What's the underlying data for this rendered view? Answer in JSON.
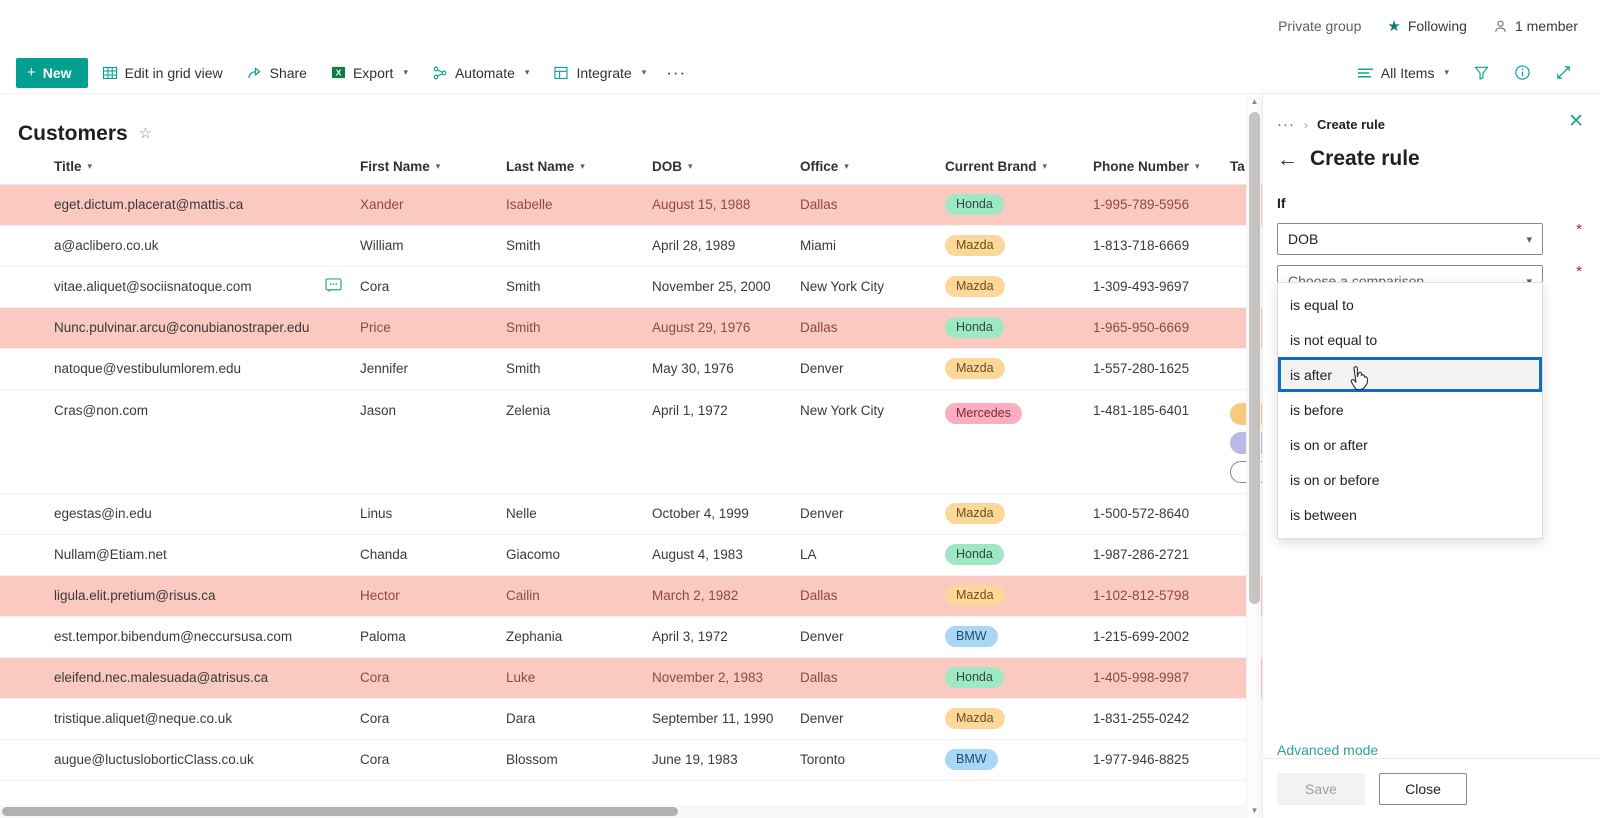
{
  "site_bar": {
    "privacy_label": "Private group",
    "following_label": "Following",
    "members_label": "1 member"
  },
  "command_bar": {
    "new_label": "New",
    "edit_grid_label": "Edit in grid view",
    "share_label": "Share",
    "export_label": "Export",
    "automate_label": "Automate",
    "integrate_label": "Integrate",
    "overflow_label": "···",
    "view_label": "All Items"
  },
  "list": {
    "title": "Customers",
    "columns": [
      "Title",
      "First Name",
      "Last Name",
      "DOB",
      "Office",
      "Current Brand",
      "Phone Number",
      "Ta"
    ],
    "rows": [
      {
        "title": "eget.dictum.placerat@mattis.ca",
        "first": "Xander",
        "last": "Isabelle",
        "dob": "August 15, 1988",
        "office": "Dallas",
        "brand": "Honda",
        "brand_class": "honda",
        "phone": "1-995-789-5956",
        "flagged": true,
        "note": false,
        "tall": false,
        "tags": []
      },
      {
        "title": "a@aclibero.co.uk",
        "first": "William",
        "last": "Smith",
        "dob": "April 28, 1989",
        "office": "Miami",
        "brand": "Mazda",
        "brand_class": "mazda",
        "phone": "1-813-718-6669",
        "flagged": false,
        "note": false,
        "tall": false,
        "tags": []
      },
      {
        "title": "vitae.aliquet@sociisnatoque.com",
        "first": "Cora",
        "last": "Smith",
        "dob": "November 25, 2000",
        "office": "New York City",
        "brand": "Mazda",
        "brand_class": "mazda",
        "phone": "1-309-493-9697",
        "flagged": false,
        "note": true,
        "tall": false,
        "tags": []
      },
      {
        "title": "Nunc.pulvinar.arcu@conubianostraper.edu",
        "first": "Price",
        "last": "Smith",
        "dob": "August 29, 1976",
        "office": "Dallas",
        "brand": "Honda",
        "brand_class": "honda",
        "phone": "1-965-950-6669",
        "flagged": true,
        "note": false,
        "tall": false,
        "tags": []
      },
      {
        "title": "natoque@vestibulumlorem.edu",
        "first": "Jennifer",
        "last": "Smith",
        "dob": "May 30, 1976",
        "office": "Denver",
        "brand": "Mazda",
        "brand_class": "mazda",
        "phone": "1-557-280-1625",
        "flagged": false,
        "note": false,
        "tall": false,
        "tags": []
      },
      {
        "title": "Cras@non.com",
        "first": "Jason",
        "last": "Zelenia",
        "dob": "April 1, 1972",
        "office": "New York City",
        "brand": "Mercedes",
        "brand_class": "mercedes",
        "phone": "1-481-185-6401",
        "flagged": false,
        "note": false,
        "tall": true,
        "tags": [
          "t-orange",
          "t-purple",
          "t-plain"
        ]
      },
      {
        "title": "egestas@in.edu",
        "first": "Linus",
        "last": "Nelle",
        "dob": "October 4, 1999",
        "office": "Denver",
        "brand": "Mazda",
        "brand_class": "mazda",
        "phone": "1-500-572-8640",
        "flagged": false,
        "note": false,
        "tall": false,
        "tags": []
      },
      {
        "title": "Nullam@Etiam.net",
        "first": "Chanda",
        "last": "Giacomo",
        "dob": "August 4, 1983",
        "office": "LA",
        "brand": "Honda",
        "brand_class": "honda",
        "phone": "1-987-286-2721",
        "flagged": false,
        "note": false,
        "tall": false,
        "tags": []
      },
      {
        "title": "ligula.elit.pretium@risus.ca",
        "first": "Hector",
        "last": "Cailin",
        "dob": "March 2, 1982",
        "office": "Dallas",
        "brand": "Mazda",
        "brand_class": "mazda",
        "phone": "1-102-812-5798",
        "flagged": true,
        "note": false,
        "tall": false,
        "tags": []
      },
      {
        "title": "est.tempor.bibendum@neccursusa.com",
        "first": "Paloma",
        "last": "Zephania",
        "dob": "April 3, 1972",
        "office": "Denver",
        "brand": "BMW",
        "brand_class": "bmw",
        "phone": "1-215-699-2002",
        "flagged": false,
        "note": false,
        "tall": false,
        "tags": []
      },
      {
        "title": "eleifend.nec.malesuada@atrisus.ca",
        "first": "Cora",
        "last": "Luke",
        "dob": "November 2, 1983",
        "office": "Dallas",
        "brand": "Honda",
        "brand_class": "honda",
        "phone": "1-405-998-9987",
        "flagged": true,
        "note": false,
        "tall": false,
        "tags": []
      },
      {
        "title": "tristique.aliquet@neque.co.uk",
        "first": "Cora",
        "last": "Dara",
        "dob": "September 11, 1990",
        "office": "Denver",
        "brand": "Mazda",
        "brand_class": "mazda",
        "phone": "1-831-255-0242",
        "flagged": false,
        "note": false,
        "tall": false,
        "tags": []
      },
      {
        "title": "augue@luctusloborticClass.co.uk",
        "first": "Cora",
        "last": "Blossom",
        "dob": "June 19, 1983",
        "office": "Toronto",
        "brand": "BMW",
        "brand_class": "bmw",
        "phone": "1-977-946-8825",
        "flagged": false,
        "note": false,
        "tall": false,
        "tags": []
      }
    ]
  },
  "panel": {
    "breadcrumb_dots": "···",
    "breadcrumb_sep": "›",
    "breadcrumb_current": "Create rule",
    "title": "Create rule",
    "if_label": "If",
    "field_value": "DOB",
    "comparison_placeholder": "Choose a comparison",
    "required_marker": "*",
    "comparison_options": [
      "is equal to",
      "is not equal to",
      "is after",
      "is before",
      "is on or after",
      "is on or before",
      "is between"
    ],
    "focused_option": "is after",
    "advanced_mode_label": "Advanced mode",
    "save_label": "Save",
    "close_label": "Close"
  },
  "colors": {
    "accent_teal": "#03a092",
    "flag_row": "#fac9c0",
    "focus_blue": "#0f6cbd",
    "required_red": "#a4262c"
  }
}
